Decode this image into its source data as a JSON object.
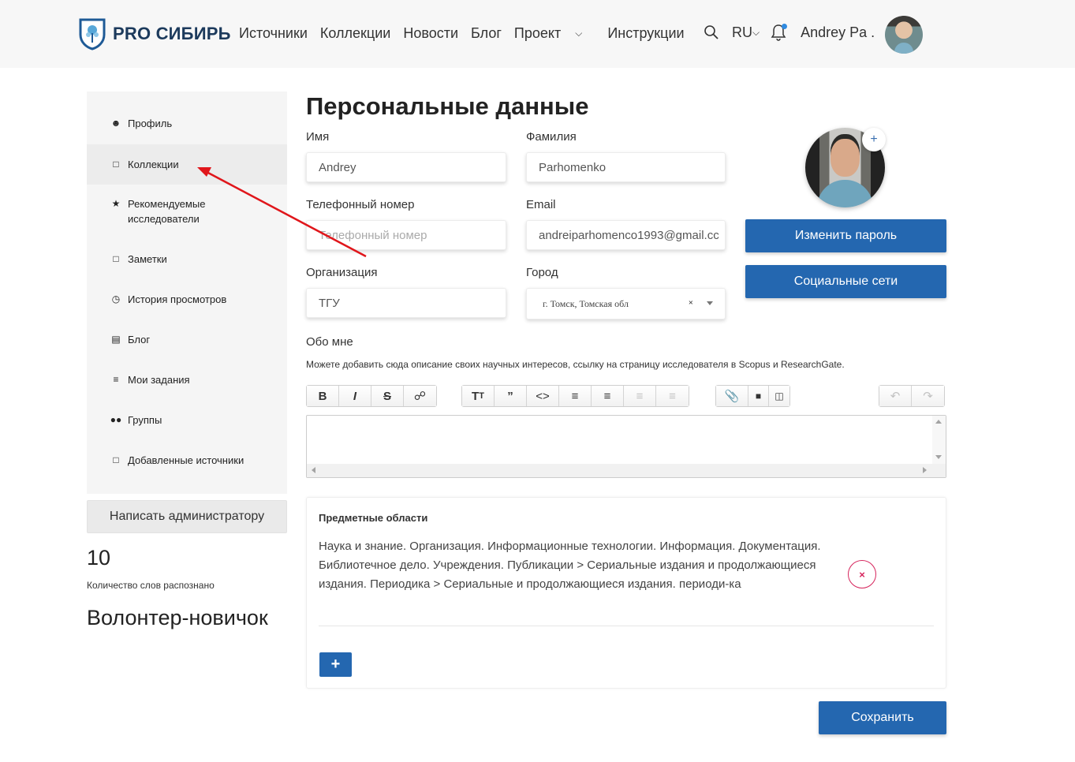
{
  "header": {
    "logo_text": "PRO СИБИРЬ",
    "nav": [
      "Источники",
      "Коллекции",
      "Новости",
      "Блог",
      "Проект",
      "Инструкции"
    ],
    "lang": "RU",
    "username": "Andrey Pa ."
  },
  "sidebar": {
    "items": [
      {
        "label": "Профиль",
        "icon": "user-icon"
      },
      {
        "label": "Коллекции",
        "icon": "bookmark-icon"
      },
      {
        "label": "Рекомендуемые исследователи",
        "icon": "award-icon"
      },
      {
        "label": "Заметки",
        "icon": "comment-icon"
      },
      {
        "label": "История просмотров",
        "icon": "clock-icon"
      },
      {
        "label": "Блог",
        "icon": "newspaper-icon"
      },
      {
        "label": "Мои задания",
        "icon": "task-list-icon"
      },
      {
        "label": "Группы",
        "icon": "users-icon"
      },
      {
        "label": "Добавленные источники",
        "icon": "folder-icon"
      }
    ],
    "admin_button": "Написать администратору",
    "word_count": "10",
    "word_count_label": "Количество слов распознано",
    "rank": "Волонтер-новичок"
  },
  "form": {
    "title": "Персональные данные",
    "first_name_label": "Имя",
    "first_name": "Andrey",
    "last_name_label": "Фамилия",
    "last_name": "Parhomenko",
    "phone_label": "Телефонный номер",
    "phone_placeholder": "Телефонный номер",
    "email_label": "Email",
    "email": "andreiparhomenco1993@gmail.cc",
    "org_label": "Организация",
    "org": "ТГУ",
    "city_label": "Город",
    "city": "г. Томск, Томская обл",
    "about_label": "Обо мне",
    "about_hint": "Можете добавить сюда описание своих научных интересов, ссылку на страницу исследователя в Scopus и ResearchGate.",
    "change_password": "Изменить пароль",
    "social": "Социальные сети",
    "save": "Сохранить"
  },
  "subjects": {
    "title": "Предметные области",
    "text": "Наука и знание. Организация. Информационные технологии. Информация. Документация. Библиотечное дело. Учреждения. Публикации > Сериальные издания и продолжающиеся издания. Периодика > Сериальные и продолжающиеся издания. периоди-ка",
    "add": "+"
  },
  "colors": {
    "primary": "#2467b0",
    "remove": "#d6245c",
    "arrow": "#e0161b"
  }
}
